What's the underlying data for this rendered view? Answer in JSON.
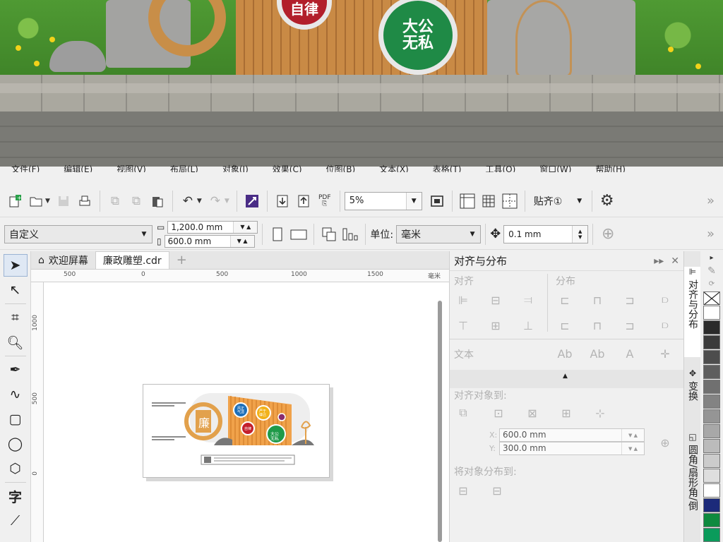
{
  "photo_menu": [
    "文件(F)",
    "编辑(E)",
    "视图(V)",
    "布局(L)",
    "对象(J)",
    "效果(C)",
    "位图(B)",
    "文本(X)",
    "表格(T)",
    "工具(O)",
    "窗口(W)",
    "帮助(H)"
  ],
  "photo_badges": {
    "badge1": "自律",
    "badge2": "大公\n无私"
  },
  "toolbar1": {
    "new_icon": "new-document-icon",
    "pdf_label": "PDF",
    "zoom_value": "5%",
    "snap_label": "贴齐①"
  },
  "toolbar2": {
    "page_size": "自定义",
    "width": "1,200.0 mm",
    "height": "600.0 mm",
    "unit_label": "单位:",
    "unit_value": "毫米",
    "nudge_value": "0.1 mm"
  },
  "tabs": {
    "welcome": "欢迎屏幕",
    "document": "廉政雕塑.cdr",
    "plus": "+"
  },
  "ruler": {
    "h_ticks": [
      "500",
      "0",
      "500",
      "1000",
      "1500"
    ],
    "h_unit": "毫米",
    "v_ticks": [
      "1000",
      "500",
      "0"
    ]
  },
  "docker": {
    "title": "对齐与分布",
    "align_label": "对齐",
    "distribute_label": "分布",
    "text_label": "文本",
    "align_to_label": "对齐对象到:",
    "x_label": "X:",
    "x_value": "600.0 mm",
    "y_label": "Y:",
    "y_value": "300.0 mm",
    "distribute_to_label": "将对象分布到:"
  },
  "side_tabs": {
    "tab1": "对齐与分布",
    "tab2": "变换",
    "tab3": "圆角/扇形角/倒"
  },
  "palette": {
    "colors": [
      "#ffffff",
      "#2b2b2b",
      "#3a3a3a",
      "#4d4d4d",
      "#5e5e5e",
      "#707070",
      "#838383",
      "#959595",
      "#a8a8a8",
      "#bbbbbb",
      "#cccccc",
      "#dedede",
      "#ffffff",
      "#1c2a7a",
      "#0f8a3f",
      "#0a9b5b"
    ]
  },
  "artboard": {
    "center_char": "廉",
    "b1": "风正\n气清",
    "b2": "严于\n律己",
    "b3": "自律",
    "b4": "大公\n无私"
  }
}
